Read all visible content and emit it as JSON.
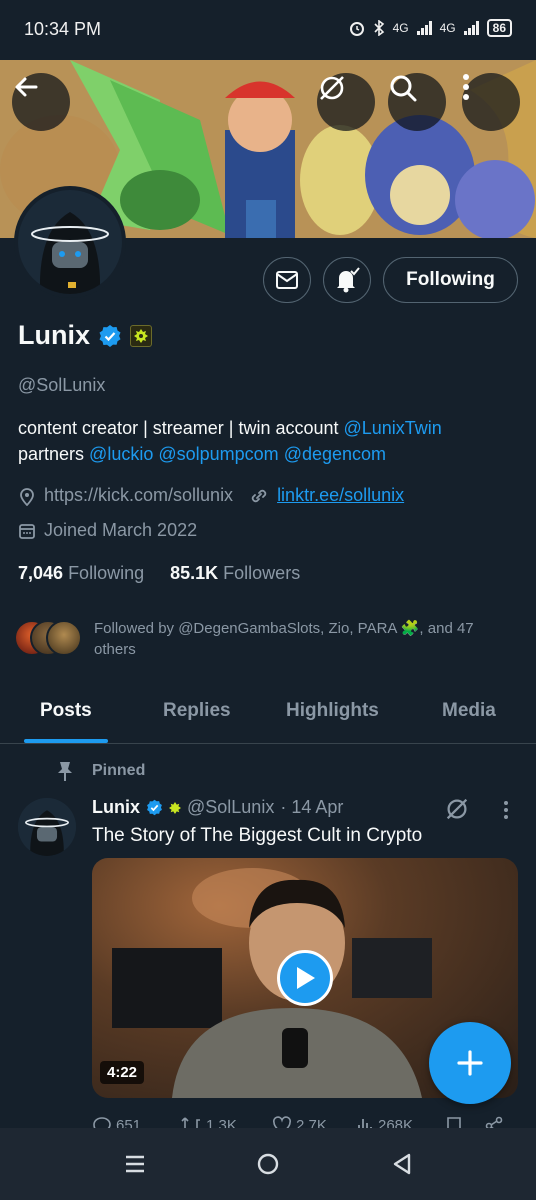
{
  "status_bar": {
    "time": "10:34 PM",
    "network_1": "4G",
    "network_2": "4G",
    "battery": "86"
  },
  "profile": {
    "name": "Lunix",
    "handle": "@SolLunix",
    "bio_line1": "content creator | streamer | twin account ",
    "bio_mention1": "@LunixTwin",
    "bio_line2": "partners ",
    "bio_mentions2": [
      "@luckio",
      "@solpumpcom",
      "@degencom"
    ],
    "website": "https://kick.com/sollunix",
    "link": "linktr.ee/sollunix",
    "joined": "Joined March 2022",
    "following_count": "7,046",
    "following_label": "Following",
    "followers_count": "85.1K",
    "followers_label": "Followers",
    "followed_by": "Followed by @DegenGambaSlots, Zio, PARA 🧩, and 47 others",
    "follow_button": "Following"
  },
  "tabs": [
    "Posts",
    "Replies",
    "Highlights",
    "Media"
  ],
  "post": {
    "pinned_label": "Pinned",
    "author_name": "Lunix",
    "author_handle": "@SolLunix",
    "date": "· 14 Apr",
    "text": "The Story of The Biggest Cult in Crypto",
    "video_duration": "4:22",
    "replies": "651",
    "reposts": "1.3K",
    "likes": "2.7K",
    "views": "268K"
  },
  "icons": {
    "back": "back-arrow-icon",
    "grok": "grok-icon",
    "search": "search-icon",
    "more": "more-vertical-icon",
    "message": "mail-icon",
    "notify": "bell-check-icon",
    "location_link": "location-pin-icon",
    "chain_link": "link-icon",
    "calendar": "calendar-icon",
    "pin": "pin-icon"
  },
  "colors": {
    "background": "#15202b",
    "accent": "#1d9bf0",
    "muted": "#8b98a5",
    "text": "#f7f9f9"
  }
}
